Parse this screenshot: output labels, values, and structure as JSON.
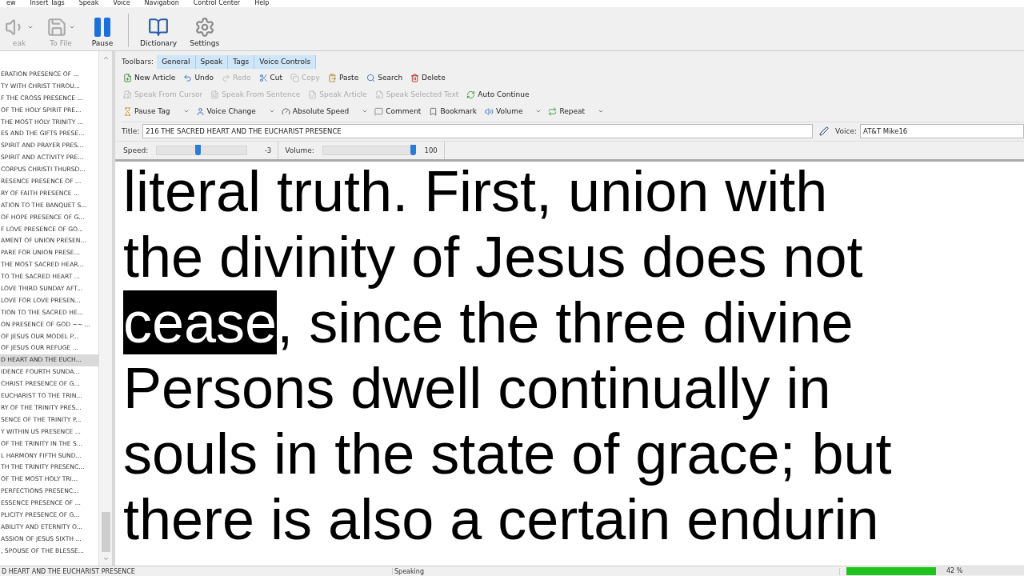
{
  "menu": [
    "ew",
    "Insert Tags",
    "Speak",
    "Voice",
    "Navigation",
    "Control Center",
    "Help"
  ],
  "main_toolbar": [
    {
      "label": "eak",
      "disabled": true,
      "dropdown": true
    },
    {
      "label": "To File",
      "disabled": true,
      "dropdown": true
    },
    {
      "label": "Pause",
      "disabled": false,
      "dropdown": false
    },
    {
      "label": "Dictionary",
      "disabled": false,
      "dropdown": false
    },
    {
      "label": "Settings",
      "disabled": false,
      "dropdown": false
    }
  ],
  "articles": [
    {
      "title": "ERATION PRESENCE OF ...",
      "selected": false
    },
    {
      "title": "TY WITH CHRIST THROU...",
      "selected": false
    },
    {
      "title": "F THE CROSS PRESENCE ...",
      "selected": false
    },
    {
      "title": "OF THE HOLY SPIRIT PRE...",
      "selected": false
    },
    {
      "title": "THE MOST HOLY TRINITY ...",
      "selected": false
    },
    {
      "title": "ES AND THE GIFTS PRESE...",
      "selected": false
    },
    {
      "title": "SPIRIT AND PRAYER PRES...",
      "selected": false
    },
    {
      "title": "SPIRIT AND ACTIVITY PRE...",
      "selected": false
    },
    {
      "title": "CORPUS CHRISTI THURSD...",
      "selected": false
    },
    {
      "title": "RESENCE PRESENCE OF ...",
      "selected": false
    },
    {
      "title": "RY OF FAITH PRESENCE ...",
      "selected": false
    },
    {
      "title": "ATION TO THE BANQUET S...",
      "selected": false
    },
    {
      "title": "OF HOPE PRESENCE OF G...",
      "selected": false
    },
    {
      "title": "F LOVE PRESENCE OF GO...",
      "selected": false
    },
    {
      "title": "AMENT OF UNION PRESEN...",
      "selected": false
    },
    {
      "title": "PARE FOR UNION PRESE...",
      "selected": false
    },
    {
      "title": "THE MOST SACRED HEAR...",
      "selected": false
    },
    {
      "title": "TO THE SACRED HEART ...",
      "selected": false
    },
    {
      "title": "LOVE THIRD SUNDAY AFT...",
      "selected": false
    },
    {
      "title": "LOVE FOR LOVE PRESEN...",
      "selected": false
    },
    {
      "title": "TION TO THE SACRED HE...",
      "selected": false
    },
    {
      "title": "ON PRESENCE OF GOD ~~ ...",
      "selected": false
    },
    {
      "title": "OF JESUS OUR MODEL P...",
      "selected": false
    },
    {
      "title": "OF JESUS OUR REFUGE ...",
      "selected": false
    },
    {
      "title": "D HEART AND THE EUCH...",
      "selected": true
    },
    {
      "title": "IDENCE FOURTH SUNDA...",
      "selected": false
    },
    {
      "title": "CHRIST PRESENCE OF G...",
      "selected": false
    },
    {
      "title": "EUCHARIST TO THE TRIN...",
      "selected": false
    },
    {
      "title": "RY OF THE TRINITY PRES...",
      "selected": false
    },
    {
      "title": "SENCE OF THE TRINITY P...",
      "selected": false
    },
    {
      "title": "Y WITHIN US PRESENCE ...",
      "selected": false
    },
    {
      "title": "OF THE TRINITY IN THE S...",
      "selected": false
    },
    {
      "title": "L HARMONY FIFTH SUND...",
      "selected": false
    },
    {
      "title": "TH THE TRINITY PRESENC...",
      "selected": false
    },
    {
      "title": "OF THE MOST HOLY TRI...",
      "selected": false
    },
    {
      "title": "PERFECTIONS PRESENC...",
      "selected": false
    },
    {
      "title": "ESSENCE PRESENCE OF ...",
      "selected": false
    },
    {
      "title": "PLICITY PRESENCE OF G...",
      "selected": false
    },
    {
      "title": "ABILITY AND ETERNITY O...",
      "selected": false
    },
    {
      "title": "ASSION OF JESUS SIXTH ...",
      "selected": false
    },
    {
      "title": ", SPOUSE OF THE BLESSE...",
      "selected": false
    }
  ],
  "toolbars": {
    "label": "Toolbars:",
    "tabs": [
      {
        "label": "General",
        "on": true
      },
      {
        "label": "Speak",
        "on": true
      },
      {
        "label": "Tags",
        "on": true
      },
      {
        "label": "Voice Controls",
        "on": true
      }
    ]
  },
  "toolbar_rows": [
    [
      {
        "label": "New Article",
        "disabled": false,
        "dropdown": false
      },
      {
        "label": "Undo",
        "disabled": false,
        "dropdown": false
      },
      {
        "label": "Redo",
        "disabled": true,
        "dropdown": false
      },
      {
        "label": "Cut",
        "disabled": false,
        "dropdown": false
      },
      {
        "label": "Copy",
        "disabled": true,
        "dropdown": false
      },
      {
        "label": "Paste",
        "disabled": false,
        "dropdown": false
      },
      {
        "label": "Search",
        "disabled": false,
        "dropdown": false
      },
      {
        "label": "Delete",
        "disabled": false,
        "dropdown": false
      }
    ],
    [
      {
        "label": "Speak From Cursor",
        "disabled": true,
        "dropdown": false
      },
      {
        "label": "Speak From Sentence",
        "disabled": true,
        "dropdown": false
      },
      {
        "label": "Speak Article",
        "disabled": true,
        "dropdown": false
      },
      {
        "label": "Speak Selected Text",
        "disabled": true,
        "dropdown": false
      },
      {
        "label": "Auto Continue",
        "disabled": false,
        "dropdown": false
      }
    ],
    [
      {
        "label": "Pause Tag",
        "disabled": false,
        "dropdown": true
      },
      {
        "label": "Voice Change",
        "disabled": false,
        "dropdown": true
      },
      {
        "label": "Absolute Speed",
        "disabled": false,
        "dropdown": true
      },
      {
        "label": "Comment",
        "disabled": false,
        "dropdown": false
      },
      {
        "label": "Bookmark",
        "disabled": false,
        "dropdown": false
      },
      {
        "label": "Volume",
        "disabled": false,
        "dropdown": true
      },
      {
        "label": "Repeat",
        "disabled": false,
        "dropdown": true
      }
    ]
  ],
  "title": {
    "label": "Title:",
    "value": "216 THE SACRED HEART AND THE EUCHARIST PRESENCE"
  },
  "voice": {
    "label": "Voice:",
    "value": "AT&T Mike16"
  },
  "speed": {
    "label": "Speed:",
    "level": 0.45,
    "reading": "-3"
  },
  "volume": {
    "label": "Volume:",
    "level": 1,
    "reading": "100"
  },
  "text_lines": [
    {
      "before": "literal truth. First, union with"
    },
    {
      "before": "the divinity of Jesus does not"
    },
    {
      "highlight": "cease",
      "after": ", since the three divine"
    },
    {
      "before": "Persons dwell continually in"
    },
    {
      "before": "souls in the state of grace; but"
    },
    {
      "before": "there is also a certain endurin"
    }
  ],
  "status_bar": {
    "article": "D HEART AND THE EUCHARIST PRESENCE",
    "state": "Speaking",
    "progress": {
      "level": 0.42,
      "reading": "42 %"
    }
  }
}
